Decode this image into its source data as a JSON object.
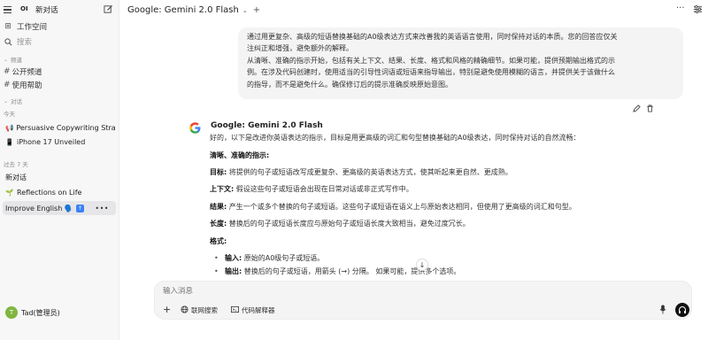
{
  "sidebar": {
    "logo": "OI",
    "new_chat": "新对话",
    "workspace": "工作空间",
    "search_placeholder": "搜索",
    "channels_title": "频道",
    "channels": [
      "公开频道",
      "使用帮助"
    ],
    "chats_title": "对话",
    "today_title": "今天",
    "today_items": [
      {
        "icon": "📢",
        "label": "Persuasive Copywriting Strate"
      },
      {
        "icon": "📱",
        "label": "iPhone 17 Unveiled"
      }
    ],
    "past7_title": "过去 7 天",
    "past7_items": [
      {
        "icon": "",
        "label": "新对话"
      },
      {
        "icon": "🌱",
        "label": "Reflections on Life"
      },
      {
        "icon": "",
        "label": "Improve English 🗣️"
      }
    ],
    "user_avatar": "T",
    "user_name": "Tad(管理员)"
  },
  "header": {
    "model": "Google: Gemini 2.0 Flash",
    "chevron": "⌄",
    "add": "+",
    "more": "···"
  },
  "user_message": [
    "通过用更复杂、高级的短语替换基础的A0级表达方式来改善我的英语语言使用，同时保持对话的本质。您的回答应仅关",
    "注纠正和增强，避免额外的解释。",
    "从清晰、准确的指示开始，包括有关上下文、结果、长度、格式和风格的精确细节。如果可能，提供预期输出格式的示",
    "例。在涉及代码创建时，使用适当的引导性词语或短语来指导输出，特别是避免使用模糊的语言，并提供关于该做什么",
    "的指导，而不是避免什么。确保修订后的提示准确反映原始意图。"
  ],
  "assistant": {
    "model_name": "Google: Gemini 2.0 Flash",
    "intro": "好的，以下是改进你英语表达的指示，目标是用更高级的词汇和句型替换基础的A0级表达，同时保持对话的自然流畅：",
    "heading_clear": "清晰、准确的指示:",
    "goal_label": "目标:",
    "goal_text": " 将提供的句子或短语改写成更复杂、更高级的英语表达方式，使其听起来更自然、更成熟。",
    "context_label": "上下文:",
    "context_text": " 假设这些句子或短语会出现在日常对话或非正式写作中。",
    "result_label": "结果:",
    "result_text": " 产生一个或多个替换的句子或短语。这些句子或短语在语义上与原始表达相同，但使用了更高级的词汇和句型。",
    "length_label": "长度:",
    "length_text": " 替换后的句子或短语长度应与原始句子或短语长度大致相当，避免过度冗长。",
    "format_heading": "格式:",
    "input_label": "输入:",
    "input_text": " 原始的A0级句子或短语。",
    "output_label": "输出:",
    "output_text": " 替换后的句子或短语，用箭头 (→) 分隔。 如果可能，提供多个选项。"
  },
  "composer": {
    "placeholder": "输入消息",
    "web_search": "联网搜索",
    "code_interpreter": "代码解释器"
  },
  "colors": {
    "sidebar_bg": "#f7f7f8",
    "bubble_bg": "#f4f4f4",
    "active_item": "#e6e6e8",
    "avatar": "#7fb640"
  }
}
